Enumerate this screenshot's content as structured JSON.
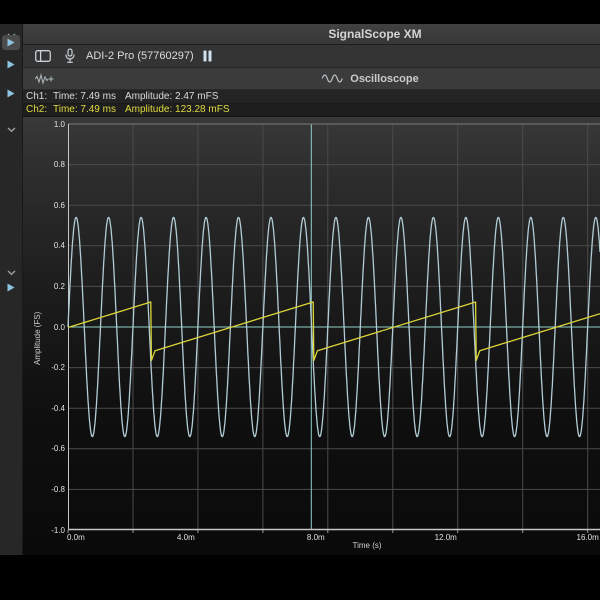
{
  "window": {
    "title": "SignalScope XM"
  },
  "toolbar": {
    "device_label": "ADI-2 Pro (57760297)",
    "icons": {
      "toggle": "sidebar-toggle",
      "input": "microphone",
      "transport": "pause"
    }
  },
  "subheader": {
    "left_icon": "waveform-add",
    "title_icon": "sine-wave",
    "tool_title": "Oscilloscope"
  },
  "readouts": [
    {
      "channel": "Ch1:",
      "time": "Time: 7.49 ms",
      "amplitude": "Amplitude: 2.47 mFS",
      "color": "#d6ded6"
    },
    {
      "channel": "Ch2:",
      "time": "Time: 7.49 ms",
      "amplitude": "Amplitude: 123.28 mFS",
      "color": "#e0da3e"
    }
  ],
  "sidebar": {
    "items": [
      {
        "icon": "chevron-down",
        "selected": false
      },
      {
        "icon": "play",
        "selected": true
      },
      {
        "icon": "play",
        "selected": false
      },
      {
        "icon": "play",
        "selected": false
      },
      {
        "icon": "chevron-down",
        "selected": false
      },
      {
        "icon": "chevron-down",
        "selected": false
      },
      {
        "icon": "play",
        "selected": false
      }
    ]
  },
  "chart_data": {
    "type": "line",
    "title": "Oscilloscope",
    "xlabel": "Time (s)",
    "ylabel": "Amplitude (FS)",
    "xlim_ms": [
      0,
      16.38
    ],
    "ylim": [
      -1,
      1
    ],
    "x_grid_step_ms": 2,
    "y_grid_step": 0.2,
    "x_ticks": [
      {
        "t_ms": 0,
        "label": "0.0m"
      },
      {
        "t_ms": 4,
        "label": "4.0m"
      },
      {
        "t_ms": 8,
        "label": "8.0m"
      },
      {
        "t_ms": 12,
        "label": "12.0m"
      },
      {
        "t_ms": 16,
        "label": "16.0m"
      }
    ],
    "y_ticks": [
      {
        "v": 1.0,
        "label": "1.0"
      },
      {
        "v": 0.8,
        "label": "0.8"
      },
      {
        "v": 0.6,
        "label": "0.6"
      },
      {
        "v": 0.4,
        "label": "0.4"
      },
      {
        "v": 0.2,
        "label": "0.2"
      },
      {
        "v": 0.0,
        "label": "0.0"
      },
      {
        "v": -0.2,
        "label": "-0.2"
      },
      {
        "v": -0.4,
        "label": "-0.4"
      },
      {
        "v": -0.6,
        "label": "-0.6"
      },
      {
        "v": -0.8,
        "label": "-0.8"
      },
      {
        "v": -1.0,
        "label": "-1.0"
      }
    ],
    "series": [
      {
        "name": "Ch1",
        "shape": "sine",
        "color": "#b2ccd6",
        "amplitude_fs": 0.54,
        "frequency_hz": 1000,
        "phase_deg": 0
      },
      {
        "name": "Ch2",
        "shape": "sawtooth",
        "color": "#dcd637",
        "amplitude_fs": 0.123,
        "frequency_hz": 200,
        "drop_time_ms": 2.55,
        "undershoot_fs": -0.165
      }
    ],
    "cursor": {
      "time_ms": 7.49,
      "color": "#8fd0c8"
    },
    "zero_line": {
      "value": 0,
      "color": "#8fd0c8"
    },
    "grid_color": "#4b4b4b",
    "axis_color": "#c6c6c6",
    "top_border_color": "#7a7a7a"
  }
}
